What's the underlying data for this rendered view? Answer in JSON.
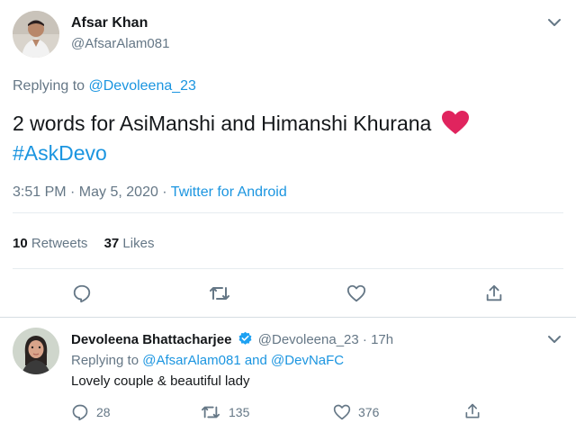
{
  "tweet": {
    "author_name": "Afsar Khan",
    "author_handle": "@AfsarAlam081",
    "replying_prefix": "Replying to",
    "replying_to": "@Devoleena_23",
    "text_main": "2 words for AsiManshi and Himanshi Khurana",
    "emoji": "heart-emoji",
    "hashtag": "#AskDevo",
    "time_date": "3:51 PM · May 5, 2020 ·",
    "source": "Twitter for Android",
    "retweets_count": "10",
    "retweets_label": "Retweets",
    "likes_count": "37",
    "likes_label": "Likes"
  },
  "reply": {
    "author_name": "Devoleena Bhattacharjee",
    "verified": true,
    "author_handle": "@Devoleena_23",
    "time": "· 17h",
    "replying_prefix": "Replying to",
    "replying_to_1": "@AfsarAlam081",
    "replying_and": "and",
    "replying_to_2": "@DevNaFC",
    "text": "Lovely couple & beautiful lady",
    "reply_count": "28",
    "retweet_count": "135",
    "like_count": "376"
  },
  "colors": {
    "link": "#1b95e0",
    "muted": "#657786",
    "heart": "#e0245e",
    "verified": "#1da1f2"
  }
}
